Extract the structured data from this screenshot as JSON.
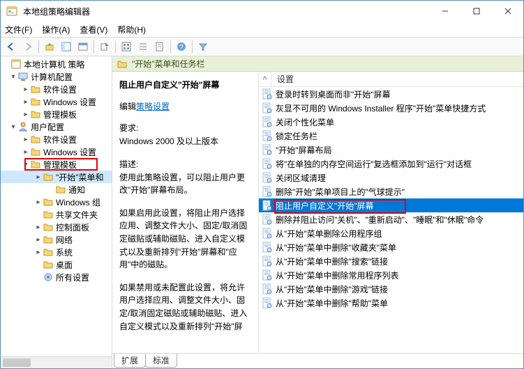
{
  "window": {
    "title": "本地组策略编辑器",
    "menus": [
      "文件(F)",
      "操作(A)",
      "查看(V)",
      "帮助(H)"
    ]
  },
  "toolbar_icons": [
    "back",
    "forward",
    "sep",
    "up",
    "folder-tree",
    "console",
    "sep",
    "export",
    "sep",
    "refresh",
    "list",
    "properties",
    "sep",
    "help",
    "sep",
    "filter"
  ],
  "tree": {
    "root": "本地计算机 策略",
    "computer_cfg": "计算机配置",
    "cc_children": [
      "软件设置",
      "Windows 设置",
      "管理模板"
    ],
    "user_cfg": "用户配置",
    "uc_children": [
      "软件设置",
      "Windows 设置"
    ],
    "uc_admin": "管理模板",
    "admin_children": [
      "\"开始\"菜单和",
      "通知",
      "Windows 组",
      "共享文件夹",
      "控制面板",
      "网络",
      "系统",
      "桌面",
      "所有设置"
    ]
  },
  "header_title": "\"开始\"菜单和任务栏",
  "detail": {
    "title": "阻止用户自定义\"开始\"屏幕",
    "edit_label": "编辑",
    "edit_link": "策略设置",
    "req_label": "要求:",
    "requirement": "Windows 2000 及以上版本",
    "desc_label": "描述:",
    "desc1": "使用此策略设置，可以阻止用户更改\"开始\"屏幕布局。",
    "desc2": "如果启用此设置，将阻止用户选择应用、调整文件大小、固定/取消固定磁贴或辅助磁贴、进入自定义模式以及重新排列\"开始\"屏幕和\"应用\"中的磁贴。",
    "desc3": "如果禁用或未配置此设置，将允许用户选择应用、调整文件大小、固定/取消固定磁贴或辅助磁贴、进入自定义模式以及重新排列\"开始\"屏"
  },
  "list": {
    "column": "设置",
    "items": [
      "登录时转到桌面而非\"开始\"屏幕",
      "灰显不可用的 Windows Installer 程序\"开始\"菜单快捷方式",
      "关闭个性化菜单",
      "锁定任务栏",
      "\"开始\"屏幕布局",
      "将\"在单独的内存空间运行\"复选框添加到\"运行\"对话框",
      "关闭区域清理",
      "删除\"开始\"菜单项目上的\"气球提示\"",
      "阻止用户自定义\"开始\"屏幕",
      "删除并阻止访问\"关机\"、\"重新启动\"、\"睡眠\"和\"休眠\"命令",
      "从\"开始\"菜单删除公用程序组",
      "从\"开始\"菜单中删除\"收藏夹\"菜单",
      "从\"开始\"菜单中删除\"搜索\"链接",
      "从\"开始\"菜单中删除常用程序列表",
      "从\"开始\"菜单中删除\"游戏\"链接",
      "从\"开始\"菜单中删除\"帮助\"菜单"
    ],
    "selected_index": 8
  },
  "tabs": [
    "扩展",
    "标准"
  ],
  "active_tab": 0
}
